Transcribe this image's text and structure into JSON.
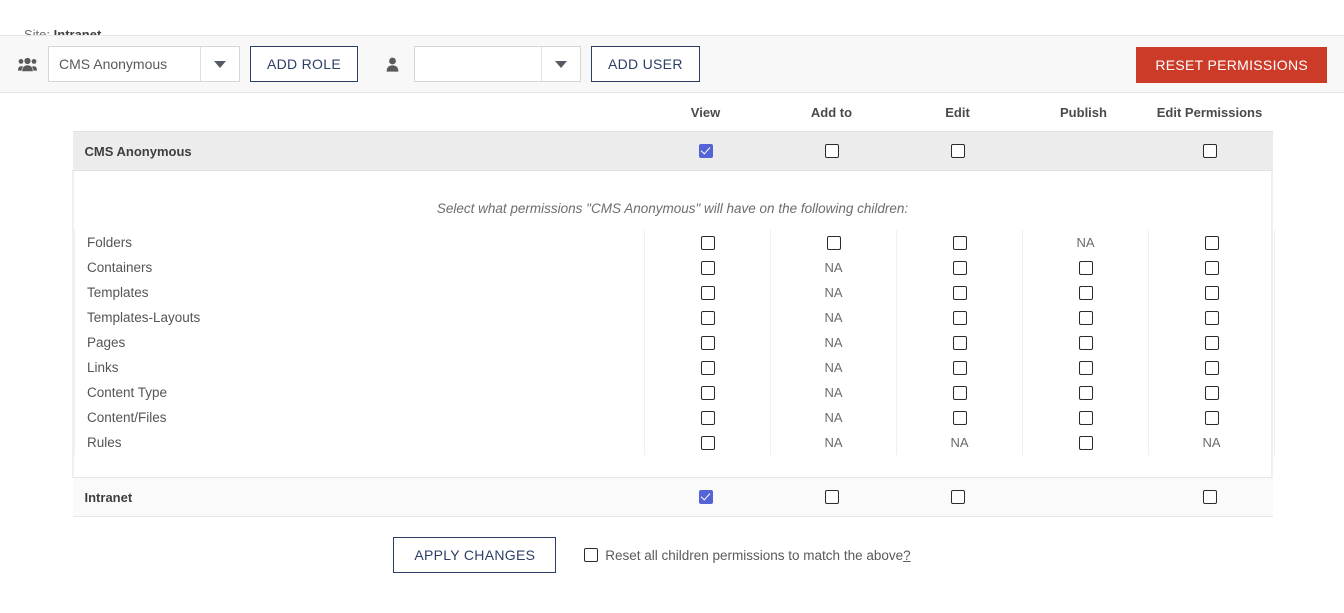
{
  "site": {
    "label": "Site:",
    "name": "Intranet"
  },
  "toolbar": {
    "group_icon": "group-users-icon",
    "role_select_value": "CMS Anonymous",
    "add_role_label": "ADD ROLE",
    "user_icon": "single-user-icon",
    "user_select_value": "",
    "user_select_placeholder": "",
    "add_user_label": "ADD USER",
    "reset_permissions_label": "RESET PERMISSIONS",
    "reset_button_color": "#cc3b28",
    "outline_button_color": "#2c3e66"
  },
  "table": {
    "columns": [
      "View",
      "Add to",
      "Edit",
      "Publish",
      "Edit Permissions"
    ],
    "header_row": {
      "name": "CMS Anonymous",
      "cells": [
        "checked",
        "unchecked",
        "unchecked",
        "none",
        "unchecked"
      ]
    },
    "children_note": "Select what permissions \"CMS Anonymous\" will have on the following children:",
    "children": [
      {
        "name": "Folders",
        "cells": [
          "unchecked",
          "unchecked",
          "unchecked",
          "NA",
          "unchecked"
        ]
      },
      {
        "name": "Containers",
        "cells": [
          "unchecked",
          "NA",
          "unchecked",
          "unchecked",
          "unchecked"
        ]
      },
      {
        "name": "Templates",
        "cells": [
          "unchecked",
          "NA",
          "unchecked",
          "unchecked",
          "unchecked"
        ]
      },
      {
        "name": "Templates-Layouts",
        "cells": [
          "unchecked",
          "NA",
          "unchecked",
          "unchecked",
          "unchecked"
        ]
      },
      {
        "name": "Pages",
        "cells": [
          "unchecked",
          "NA",
          "unchecked",
          "unchecked",
          "unchecked"
        ]
      },
      {
        "name": "Links",
        "cells": [
          "unchecked",
          "NA",
          "unchecked",
          "unchecked",
          "unchecked"
        ]
      },
      {
        "name": "Content Type",
        "cells": [
          "unchecked",
          "NA",
          "unchecked",
          "unchecked",
          "unchecked"
        ]
      },
      {
        "name": "Content/Files",
        "cells": [
          "unchecked",
          "NA",
          "unchecked",
          "unchecked",
          "unchecked"
        ]
      },
      {
        "name": "Rules",
        "cells": [
          "unchecked",
          "NA",
          "NA",
          "unchecked",
          "NA"
        ]
      }
    ],
    "footer_row": {
      "name": "Intranet",
      "cells": [
        "checked",
        "unchecked",
        "unchecked",
        "none",
        "unchecked"
      ]
    },
    "checked_color": "#5463d6",
    "header_row_bg": "#ececec",
    "footer_row_bg": "#fafafa"
  },
  "footer": {
    "apply_label": "APPLY CHANGES",
    "reset_children_checked": false,
    "reset_children_text": "Reset all children permissions to match the above",
    "help_link": "?"
  }
}
